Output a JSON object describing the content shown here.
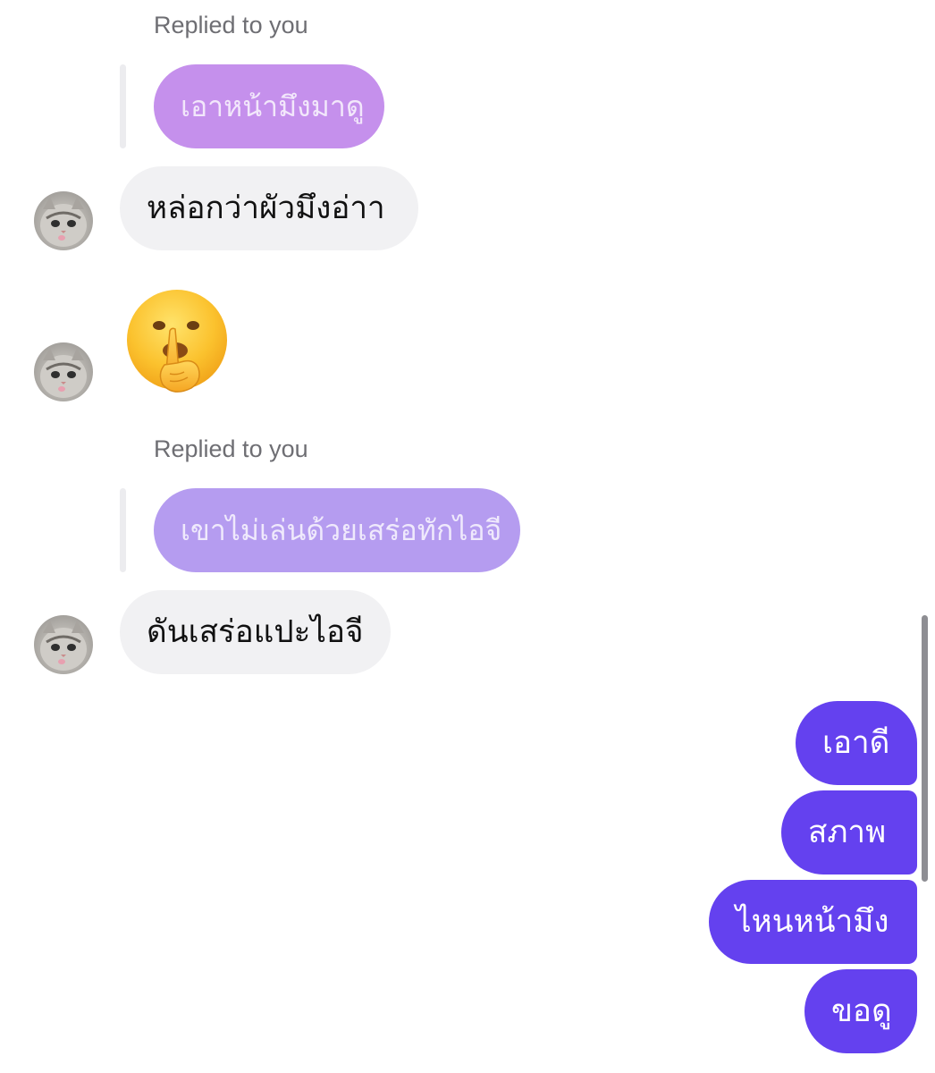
{
  "thread": {
    "reply1": {
      "label": "Replied to you",
      "quoted_text": "เอาหน้ามึงมาดู",
      "quoted_color": "#c590ec"
    },
    "msg1": "หล่อกว่าผัวมึงอ่าา",
    "emoji": "shushing-face",
    "reply2": {
      "label": "Replied to you",
      "quoted_text": "เขาไม่เล่นด้วยเสร่อทักไอจี",
      "quoted_color": "#b59cf0"
    },
    "msg2": "ดันเสร่อแปะไอจี"
  },
  "outgoing": [
    "เอาดี",
    "สภาพ",
    "ไหนหน้ามึง",
    "ขอดู"
  ],
  "colors": {
    "outgoing_bubble": "#6441ef",
    "incoming_bubble": "#f1f1f3",
    "meta_text": "#6e6e73"
  }
}
